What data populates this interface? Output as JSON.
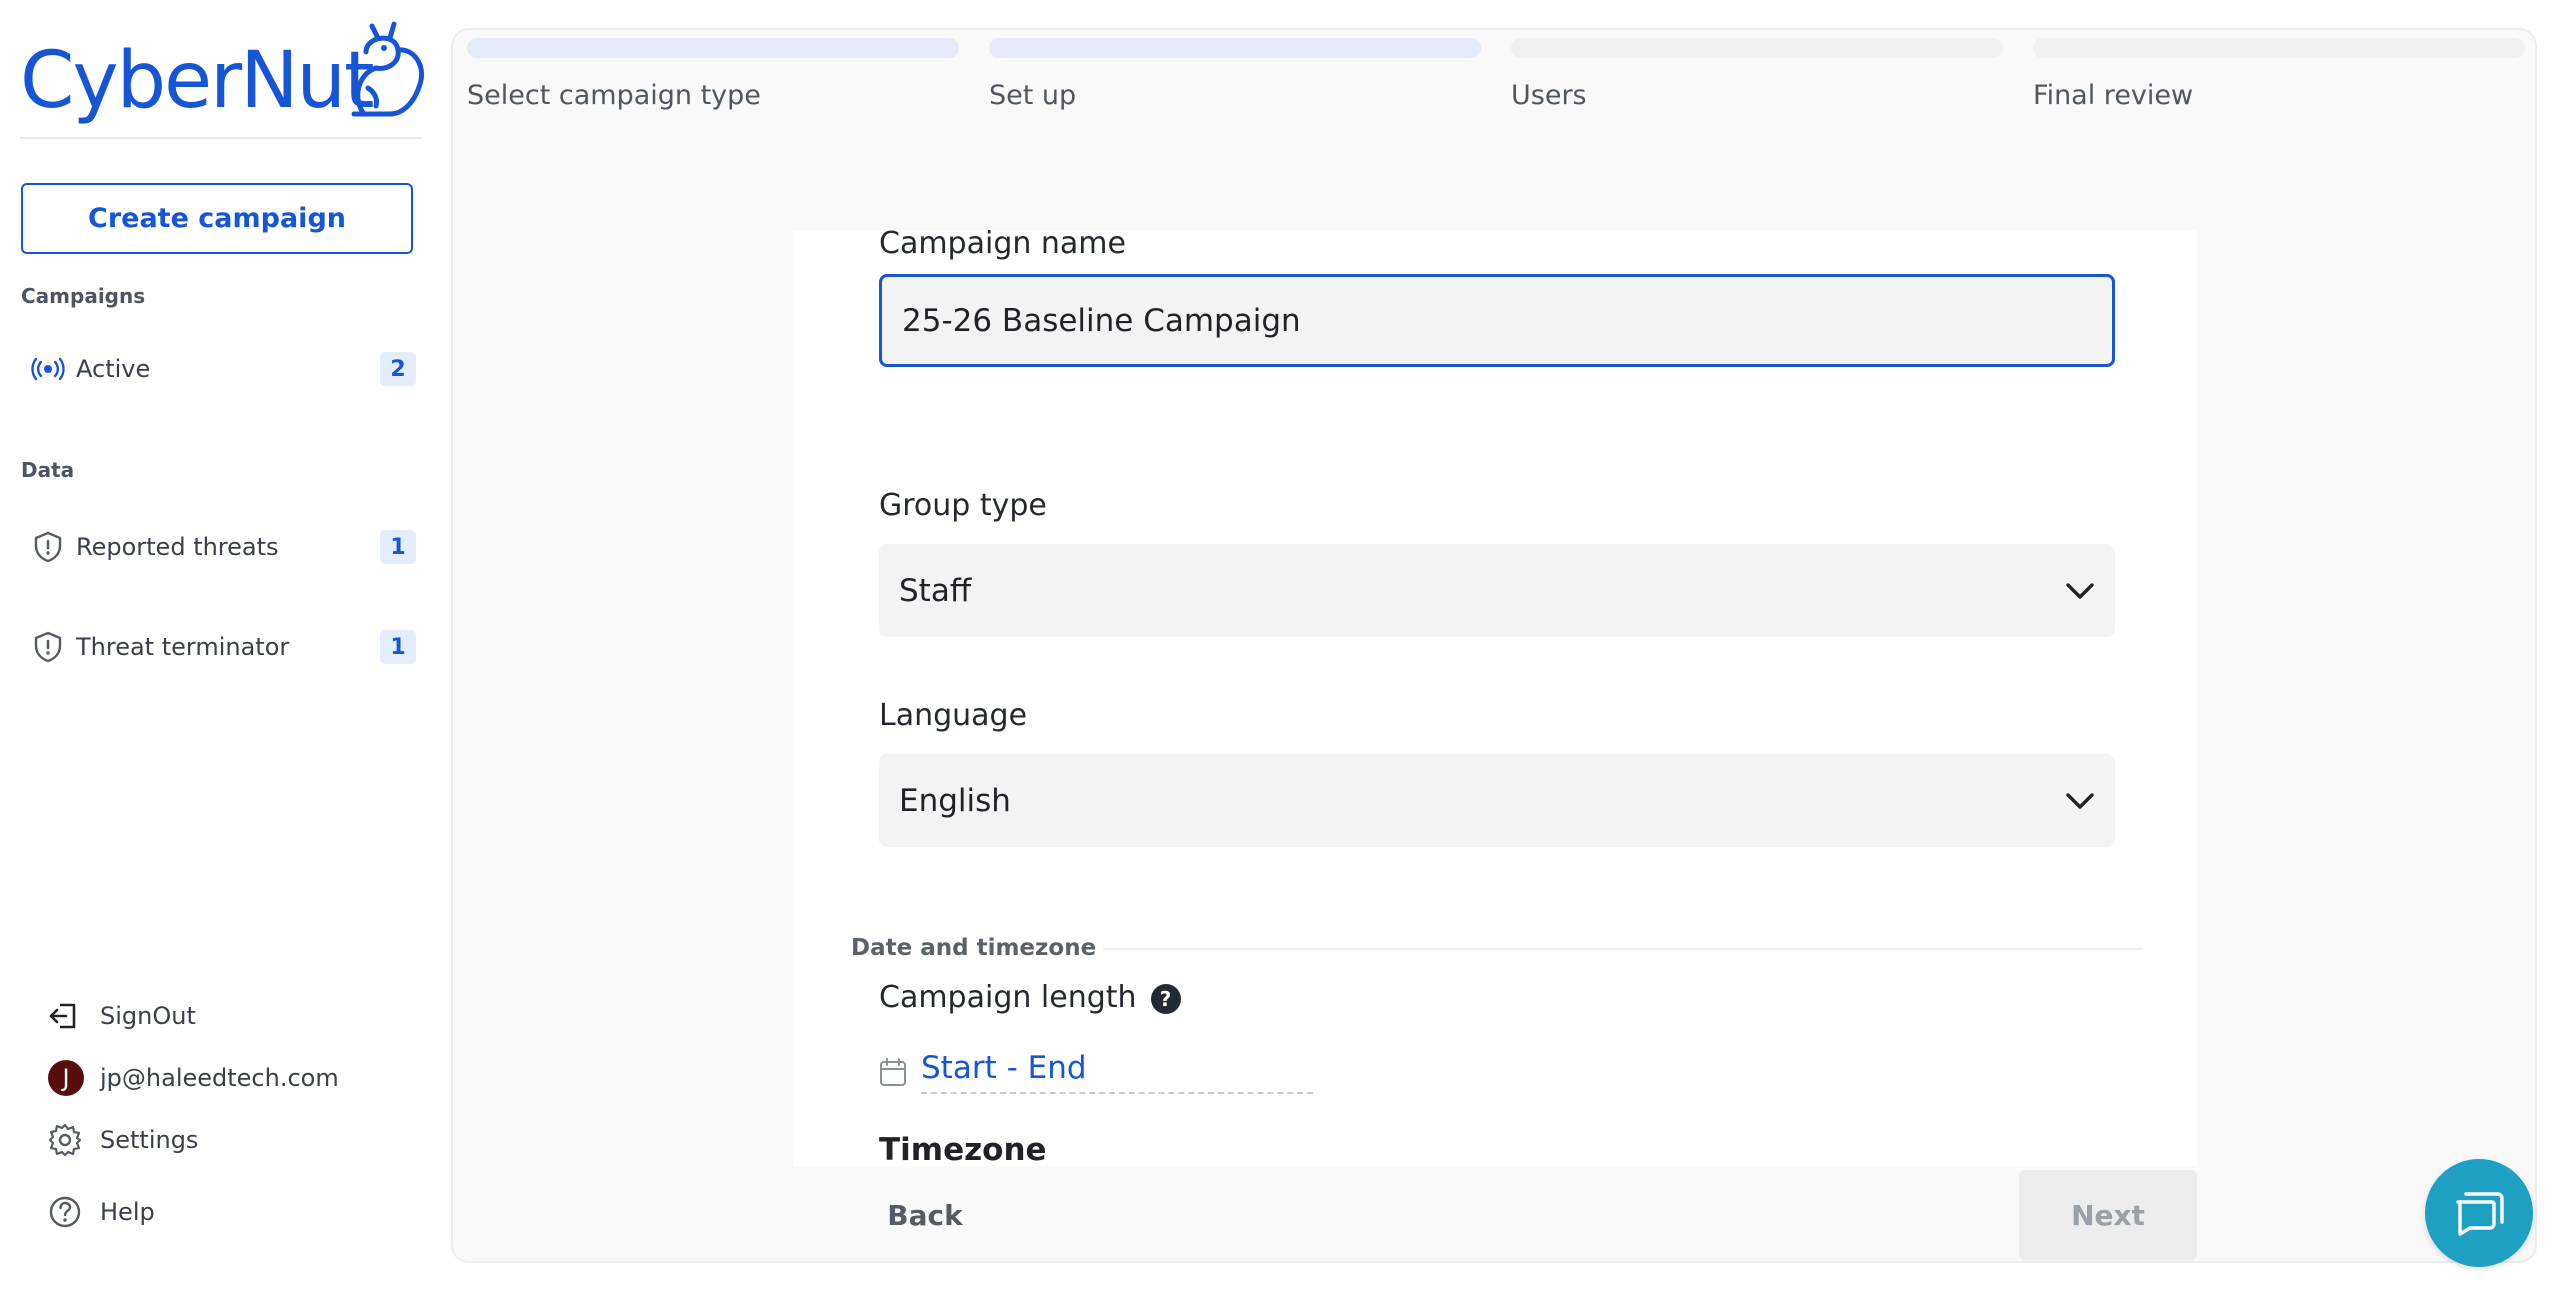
{
  "brand": {
    "name": "CyberNut",
    "color": "#1555d6"
  },
  "sidebar": {
    "create_label": "Create campaign",
    "campaigns_section": "Campaigns",
    "data_section": "Data",
    "items": [
      {
        "label": "Active",
        "count": "2",
        "icon": "broadcast-icon"
      },
      {
        "label": "Reported threats",
        "count": "1",
        "icon": "shield-icon"
      },
      {
        "label": "Threat terminator",
        "count": "1",
        "icon": "shield-icon"
      }
    ],
    "footer": [
      {
        "label": "SignOut",
        "icon": "sign-out-icon"
      },
      {
        "label": "jp@haleedtech.com",
        "icon": "avatar",
        "initial": "J"
      },
      {
        "label": "Settings",
        "icon": "gear-icon"
      },
      {
        "label": "Help",
        "icon": "help-circle-icon"
      }
    ]
  },
  "wizard": {
    "steps": [
      {
        "label": "Select campaign type",
        "done": true
      },
      {
        "label": "Set up",
        "done": true
      },
      {
        "label": "Users",
        "done": false
      },
      {
        "label": "Final review",
        "done": false
      }
    ]
  },
  "form": {
    "campaign_name_label": "Campaign name",
    "campaign_name_value": "25-26 Baseline Campaign",
    "group_type_label": "Group type",
    "group_type_value": "Staff",
    "language_label": "Language",
    "language_value": "English",
    "date_section_label": "Date and timezone",
    "campaign_length_label": "Campaign length",
    "campaign_length_help": "?",
    "date_range_placeholder": "Start - End",
    "timezone_label": "Timezone"
  },
  "actions": {
    "back_label": "Back",
    "next_label": "Next"
  },
  "colors": {
    "accent": "#1555d6",
    "chat": "#1ea0c2"
  }
}
